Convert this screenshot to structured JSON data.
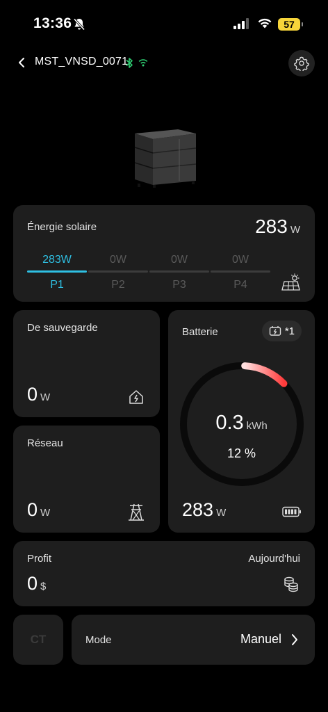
{
  "status_bar": {
    "time": "13:36",
    "battery": "57"
  },
  "header": {
    "device_name": "MST_VNSD_0071"
  },
  "solar": {
    "title": "Énergie solaire",
    "value": "283",
    "unit": "W",
    "inputs": [
      {
        "watts": "283W",
        "label": "P1",
        "active": true
      },
      {
        "watts": "0W",
        "label": "P2",
        "active": false
      },
      {
        "watts": "0W",
        "label": "P3",
        "active": false
      },
      {
        "watts": "0W",
        "label": "P4",
        "active": false
      }
    ]
  },
  "backup": {
    "title": "De sauvegarde",
    "value": "0",
    "unit": "W"
  },
  "grid": {
    "title": "Réseau",
    "value": "0",
    "unit": "W"
  },
  "battery": {
    "title": "Batterie",
    "badge": "*1",
    "energy": "0.3",
    "energy_unit": "kWh",
    "percent": "12 %",
    "percent_value": 12,
    "power": "283",
    "power_unit": "W"
  },
  "profit": {
    "title": "Profit",
    "period": "Aujourd'hui",
    "value": "0",
    "unit": "$"
  },
  "ct": {
    "label": "CT"
  },
  "mode": {
    "title": "Mode",
    "value": "Manuel"
  },
  "colors": {
    "accent": "#2fc0e3",
    "card": "#1e1e1e",
    "battery_arc": "#ff3b3b",
    "status_battery": "#f7d53a"
  }
}
